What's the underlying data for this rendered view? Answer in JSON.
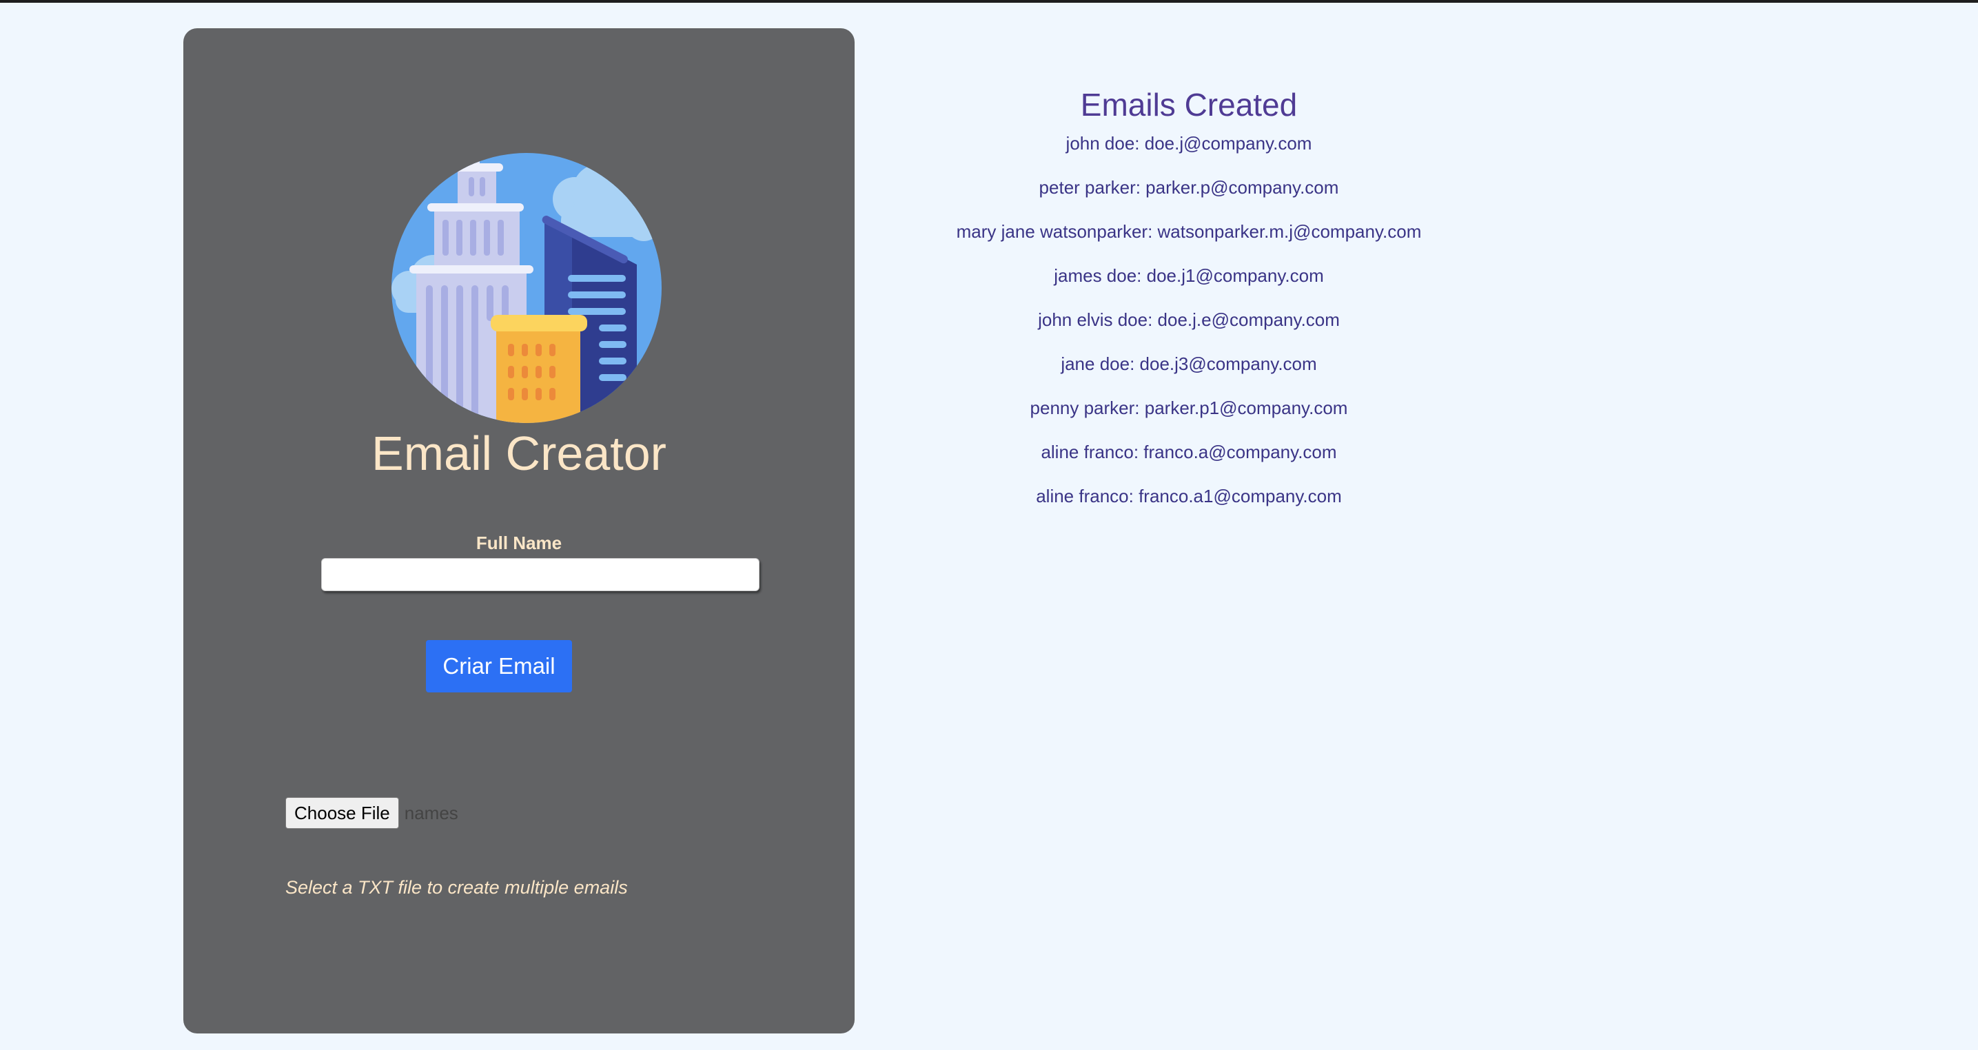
{
  "app": {
    "title": "Email Creator",
    "logo_icon": "city-buildings-icon"
  },
  "form": {
    "full_name_label": "Full Name",
    "full_name_value": "",
    "create_button_label": "Criar Email",
    "choose_file_label": "Choose File",
    "file_name": "names",
    "file_hint": "Select a TXT file to create multiple emails"
  },
  "emails": {
    "title": "Emails Created",
    "items": [
      "john doe: doe.j@company.com",
      "peter parker: parker.p@company.com",
      "mary jane watsonparker: watsonparker.m.j@company.com",
      "james doe: doe.j1@company.com",
      "john elvis doe: doe.j.e@company.com",
      "jane doe: doe.j3@company.com",
      "penny parker: parker.p1@company.com",
      "aline franco: franco.a@company.com",
      "aline franco: franco.a1@company.com"
    ]
  },
  "colors": {
    "page_background": "#f0f7fe",
    "panel_background": "#626365",
    "accent_text": "#fbe6c7",
    "button": "#2c70f4",
    "emails_text": "#3a3486"
  }
}
